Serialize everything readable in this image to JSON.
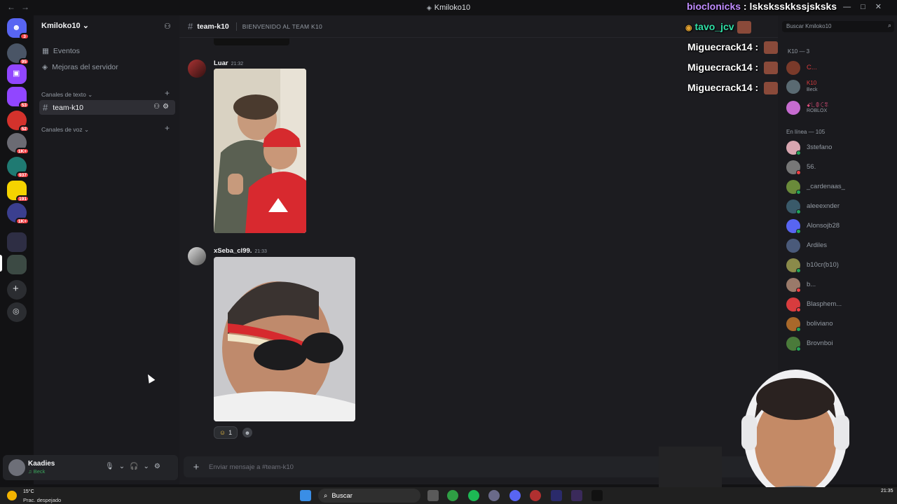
{
  "window": {
    "title": "Kmiloko10"
  },
  "rail": {
    "badges": [
      "3",
      "95",
      "53",
      "52",
      "1K+",
      "937",
      "191",
      "1K+"
    ]
  },
  "server": {
    "name": "Kmiloko10",
    "events_label": "Eventos",
    "boost_label": "Mejoras del servidor",
    "text_category": "Canales de texto",
    "voice_category": "Canales de voz",
    "active_channel": "team-k10"
  },
  "user": {
    "name": "Kaadies",
    "status": "Beck"
  },
  "chat": {
    "channel_name": "team-k10",
    "topic": "BIENVENIDO AL TEAM K10",
    "messages": [
      {
        "author": "Luar",
        "time": "21:32"
      },
      {
        "author": "xSeba_cl99.",
        "time": "21:33"
      }
    ],
    "reaction_count": "1",
    "composer_placeholder": "Enviar mensaje a #team-k10"
  },
  "members": {
    "search_placeholder": "Buscar Kmiloko10",
    "role_header": "K10 — 3",
    "online_header": "En línea — 105",
    "role_members": [
      "C...",
      "K10",
      "ꗃ꒒ꂦꉔꁄ"
    ],
    "role_member_statuses": [
      "",
      "Beck",
      "ROBLOX"
    ],
    "online_members": [
      "3stefano",
      "56.",
      "_cardenaas_",
      "aleeexnder",
      "Alonsojb28",
      "Ardiles",
      "b10cr(b10)",
      "b...",
      "Blasphem...",
      "boliviano",
      "Brovnboi"
    ]
  },
  "overlay": {
    "lines": [
      {
        "user": "bioclonicks",
        "text": "lsksksskkssjsksks",
        "color": "#c08cff"
      },
      {
        "user": "tavo_jcv",
        "text": "",
        "color": "#2fe0a6"
      },
      {
        "user": "Miguecrack14",
        "text": "",
        "color": "#ffffff"
      },
      {
        "user": "Miguecrack14",
        "text": "",
        "color": "#ffffff"
      },
      {
        "user": "Miguecrack14",
        "text": "",
        "color": "#ffffff"
      }
    ]
  },
  "taskbar": {
    "weather_temp": "15°C",
    "weather_desc": "Prac. despejado",
    "search_label": "Buscar",
    "clock": "21:35"
  },
  "colors": {
    "accent": "#5865f2",
    "online": "#23a559",
    "badge": "#f23f43"
  }
}
